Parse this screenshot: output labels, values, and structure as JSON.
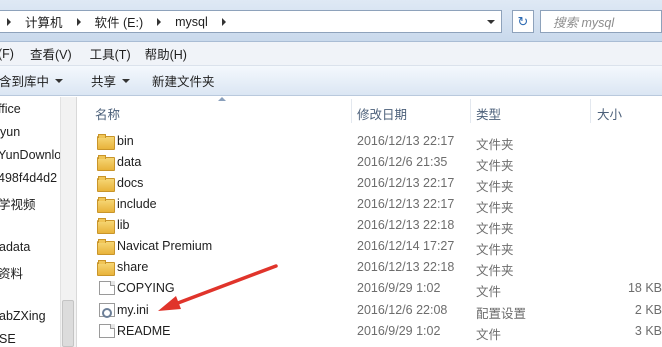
{
  "address": {
    "segments": [
      "计算机",
      "软件 (E:)",
      "mysql"
    ],
    "search_placeholder": "搜索 mysql",
    "refresh_glyph": "↻"
  },
  "menu": {
    "items": [
      "(F)",
      "查看(V)",
      "工具(T)",
      "帮助(H)"
    ]
  },
  "commands": {
    "include_library": "含到库中",
    "share": "共享",
    "new_folder": "新建文件夹"
  },
  "nav": {
    "items": [
      "ffice",
      "yun",
      "YunDownlo",
      "498f4d4d2",
      "学视频",
      "adata",
      "资料",
      "abZXing",
      "SE"
    ]
  },
  "columns": {
    "name": "名称",
    "date": "修改日期",
    "type": "类型",
    "size": "大小"
  },
  "files": [
    {
      "name": "bin",
      "date": "2016/12/13 22:17",
      "type": "文件夹",
      "size": "",
      "icon": "folder-icon"
    },
    {
      "name": "data",
      "date": "2016/12/6 21:35",
      "type": "文件夹",
      "size": "",
      "icon": "folder-icon"
    },
    {
      "name": "docs",
      "date": "2016/12/13 22:17",
      "type": "文件夹",
      "size": "",
      "icon": "folder-icon"
    },
    {
      "name": "include",
      "date": "2016/12/13 22:17",
      "type": "文件夹",
      "size": "",
      "icon": "folder-icon"
    },
    {
      "name": "lib",
      "date": "2016/12/13 22:18",
      "type": "文件夹",
      "size": "",
      "icon": "folder-icon"
    },
    {
      "name": "Navicat Premium",
      "date": "2016/12/14 17:27",
      "type": "文件夹",
      "size": "",
      "icon": "folder-icon"
    },
    {
      "name": "share",
      "date": "2016/12/13 22:18",
      "type": "文件夹",
      "size": "",
      "icon": "folder-icon"
    },
    {
      "name": "COPYING",
      "date": "2016/9/29 1:02",
      "type": "文件",
      "size": "18 KB",
      "icon": "file-icon"
    },
    {
      "name": "my.ini",
      "date": "2016/12/6 22:08",
      "type": "配置设置",
      "size": "2 KB",
      "icon": "ini-file-icon"
    },
    {
      "name": "README",
      "date": "2016/9/29 1:02",
      "type": "文件",
      "size": "3 KB",
      "icon": "file-icon"
    }
  ],
  "annotation_color": "#e0342b"
}
